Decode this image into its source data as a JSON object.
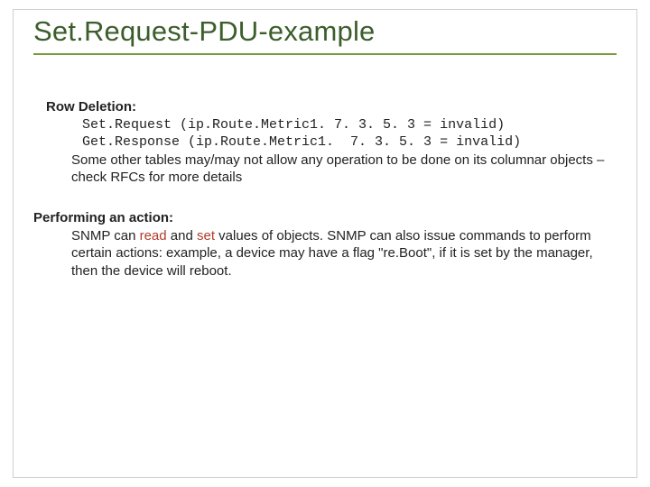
{
  "title": "Set.Request-PDU-example",
  "rowDeletion": {
    "heading": "Row Deletion:",
    "line1": "Set.Request (ip.Route.Metric1. 7. 3. 5. 3 = invalid)",
    "line2": "Get.Response (ip.Route.Metric1.  7. 3. 5. 3 = invalid)",
    "paragraph": "Some other tables may/may not allow any operation to be done on its columnar objects – check RFCs for more details"
  },
  "action": {
    "heading": "Performing an action:",
    "pre": "SNMP can ",
    "kw1": "read",
    "mid1": " and ",
    "kw2": "set",
    "post": " values of objects. SNMP can also issue commands to perform certain actions: example, a device may have a flag \"re.Boot\", if it is set by the manager, then the device will reboot."
  }
}
